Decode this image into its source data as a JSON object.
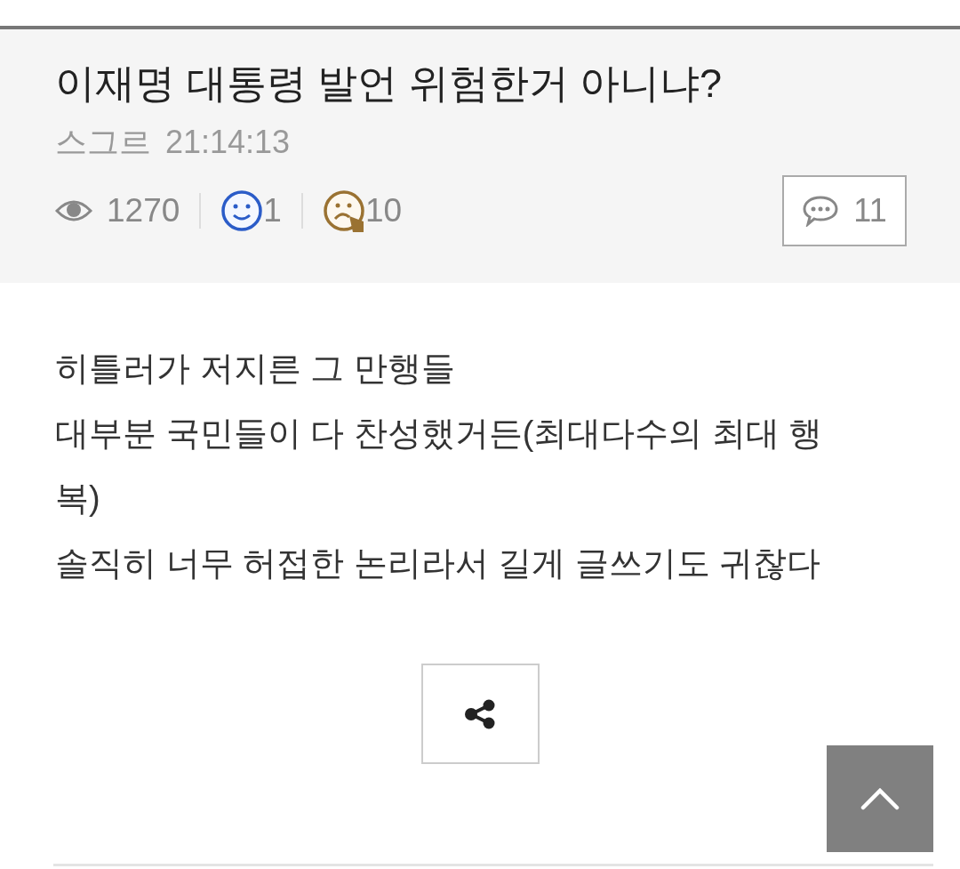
{
  "post": {
    "title": "이재명 대통령 발언 위험한거 아니냐?",
    "author": "스그르",
    "time": "21:14:13",
    "views": "1270",
    "likes": "1",
    "dislikes": "10",
    "comments": "11"
  },
  "body": [
    "히틀러가 저지른 그 만행들",
    "대부분 국민들이 다 찬성했거든(최대다수의 최대 행복)",
    "솔직히 너무 허접한 논리라서 길게 글쓰기도 귀찮다"
  ]
}
